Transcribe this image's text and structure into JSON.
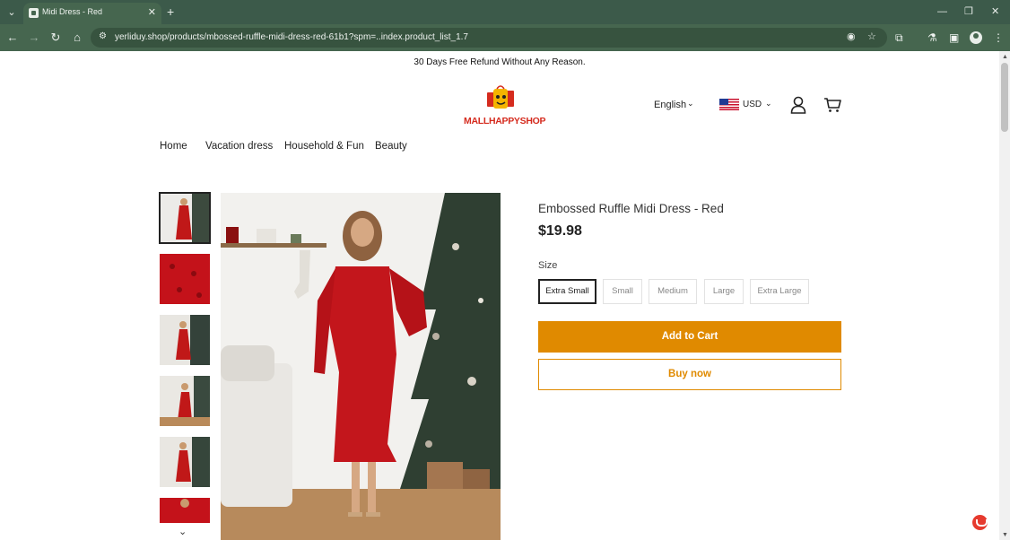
{
  "browser": {
    "tab_title": "Midi Dress - Red",
    "url": "yerliduy.shop/products/mbossed-ruffle-midi-dress-red-61b1?spm=..index.product_list_1.7"
  },
  "announcement": "30 Days Free Refund Without Any Reason.",
  "logo_text": "MALLHAPPYSHOP",
  "header": {
    "language": "English",
    "currency": "USD"
  },
  "nav": [
    {
      "label": "Home"
    },
    {
      "label": "Vacation dress"
    },
    {
      "label": "Household & Fun"
    },
    {
      "label": "Beauty"
    }
  ],
  "product": {
    "title": "Embossed Ruffle Midi Dress - Red",
    "price": "$19.98",
    "size_label": "Size",
    "sizes": [
      {
        "label": "Extra Small",
        "selected": true
      },
      {
        "label": "Small",
        "selected": false
      },
      {
        "label": "Medium",
        "selected": false
      },
      {
        "label": "Large",
        "selected": false
      },
      {
        "label": "Extra Large",
        "selected": false
      }
    ],
    "add_to_cart": "Add to Cart",
    "buy_now": "Buy now",
    "thumbnail_count": 6
  },
  "colors": {
    "accent": "#e08a00",
    "brand_red": "#d52b1e",
    "chrome": "#46664f"
  },
  "icons": {
    "user": "user-icon",
    "cart": "cart-icon",
    "chat": "chat-icon"
  }
}
